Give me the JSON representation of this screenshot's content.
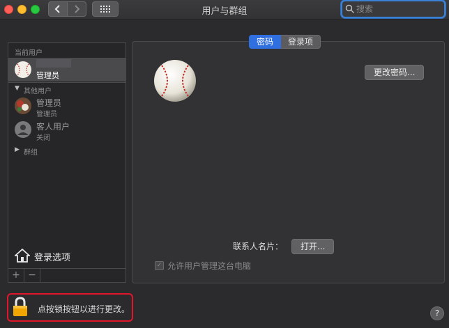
{
  "window": {
    "title": "用户与群组",
    "search_placeholder": "搜索"
  },
  "sidebar": {
    "current_users_label": "当前用户",
    "current_user": {
      "name": "管理员"
    },
    "other_users_label": "其他用户",
    "other_users": [
      {
        "name": "管理员",
        "role": "管理员"
      },
      {
        "name": "客人用户",
        "role": "关闭"
      }
    ],
    "groups_label": "群组",
    "login_options_label": "登录选项",
    "add_label": "+",
    "remove_label": "−"
  },
  "main": {
    "tabs": [
      {
        "label": "密码",
        "active": true
      },
      {
        "label": "登录项",
        "active": false
      }
    ],
    "change_password_label": "更改密码...",
    "contact_card_label": "联系人名片：",
    "open_button_label": "打开...",
    "allow_admin_label": "允许用户管理这台电脑",
    "allow_admin_checked": true
  },
  "footer": {
    "lock_text": "点按锁按钮以进行更改。",
    "help_label": "?"
  },
  "colors": {
    "accent": "#2f6fdf",
    "lock_highlight": "#e1162a",
    "search_focus": "#3b82d6"
  }
}
